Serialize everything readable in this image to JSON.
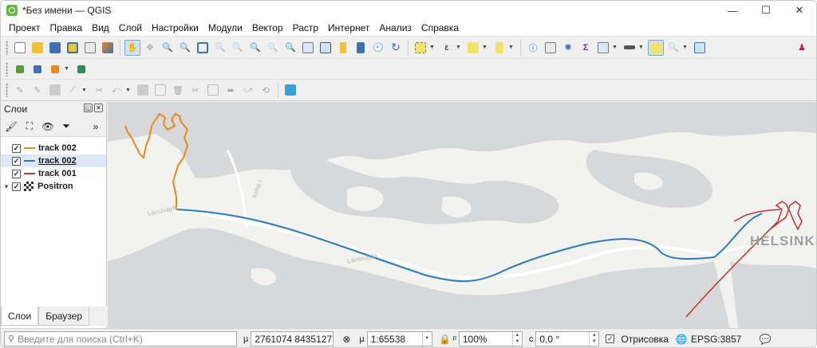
{
  "window": {
    "title": "*Без имени — QGIS",
    "controls": {
      "minimize": "—",
      "maximize": "☐",
      "close": "✕"
    }
  },
  "menu": [
    "Проект",
    "Правка",
    "Вид",
    "Слой",
    "Настройки",
    "Модули",
    "Вектор",
    "Растр",
    "Интернет",
    "Анализ",
    "Справка"
  ],
  "toolbar_icons": {
    "row1": [
      "new-project",
      "open-project",
      "save-project",
      "save-as",
      "print-layout",
      "style-manager",
      "pan",
      "pan-to-selection",
      "zoom-in",
      "zoom-out",
      "zoom-full",
      "zoom-to-selection",
      "zoom-to-layer",
      "zoom-native",
      "zoom-last",
      "zoom-next",
      "new-map-view",
      "new-3d-view",
      "new-bookmark",
      "show-bookmarks",
      "temporal-controller",
      "refresh",
      "select",
      "deselect",
      "select-by-expression",
      "identify",
      "attribute-table",
      "statistics",
      "sum",
      "field-calculator",
      "measure",
      "annotations",
      "tips",
      "help",
      "plugin"
    ],
    "row2": [
      "add-vector",
      "add-raster",
      "add-db",
      "add-wms"
    ],
    "row3": [
      "toggle-editing",
      "edit",
      "save-edits",
      "digitize",
      "vertex-tool",
      "undo",
      "redo",
      "shape",
      "cut",
      "copy",
      "paste",
      "delete",
      "move",
      "sync"
    ]
  },
  "layers_panel": {
    "title": "Слои",
    "layers": [
      {
        "name": "track 002",
        "color": "#e8891a",
        "checked": true,
        "selected": false
      },
      {
        "name": "track 002",
        "color": "#2b7bb9",
        "checked": true,
        "selected": true
      },
      {
        "name": "track 001",
        "color": "#c23232",
        "checked": true,
        "selected": false
      },
      {
        "name": "Positron",
        "color": "#333333",
        "checked": true,
        "selected": false
      }
    ],
    "tabs": [
      "Слои",
      "Браузер"
    ]
  },
  "map": {
    "labels": {
      "road1": "Länsiväylä",
      "road2": "Länsiväylä",
      "road3": "Kehä I",
      "city": "HELSINKI"
    },
    "colors": {
      "water": "#d6d8da",
      "land": "#f2f2f0",
      "orange_track": "#e8891a",
      "blue_track": "#2b7bb9",
      "red_track": "#c23232"
    }
  },
  "status": {
    "search_placeholder": "Введите для поиска (Ctrl+K)",
    "coordinate_label": "Координаты",
    "coordinate_value": "2761074  8435127",
    "scale_label": "Масштаб",
    "scale_value": "1:65538",
    "magnifier_label": "Увеличение",
    "magnifier_value": "100%",
    "rotation_label": "Поворот",
    "rotation_value": "0,0 °",
    "render_label": "Отрисовка",
    "render_checked": true,
    "crs": "EPSG:3857"
  }
}
